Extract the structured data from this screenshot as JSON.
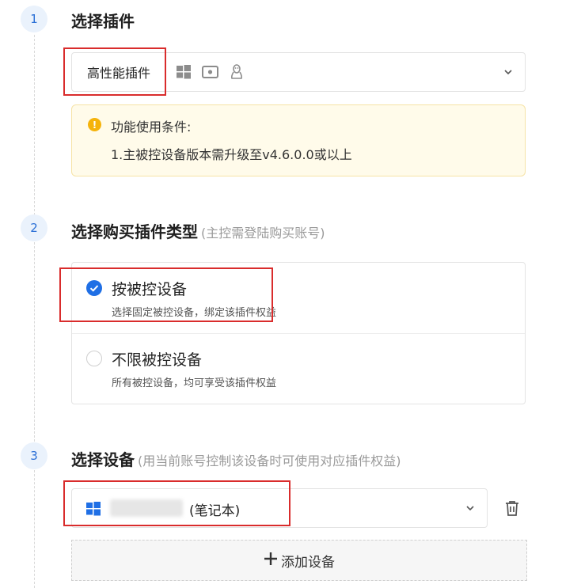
{
  "steps": [
    {
      "number": "1",
      "title": "选择插件",
      "subtitle": ""
    },
    {
      "number": "2",
      "title": "选择购买插件类型",
      "subtitle": "(主控需登陆购买账号)"
    },
    {
      "number": "3",
      "title": "选择设备",
      "subtitle": "(用当前账号控制该设备时可使用对应插件权益)"
    }
  ],
  "plugin_select": {
    "selected": "高性能插件",
    "platform_icons": [
      "windows-icon",
      "screen-icon",
      "linux-icon"
    ]
  },
  "notice": {
    "title": "功能使用条件:",
    "items": [
      "1.主被控设备版本需升级至v4.6.0.0或以上"
    ]
  },
  "purchase_types": [
    {
      "title": "按被控设备",
      "desc": "选择固定被控设备，绑定该插件权益",
      "checked": true
    },
    {
      "title": "不限被控设备",
      "desc": "所有被控设备，均可享受该插件权益",
      "checked": false
    }
  ],
  "device_select": {
    "device_type": "(笔记本)"
  },
  "add_device_label": "添加设备",
  "colors": {
    "accent": "#1f6fe5",
    "highlight_box": "#d92c2c",
    "warning": "#f5b30b"
  }
}
